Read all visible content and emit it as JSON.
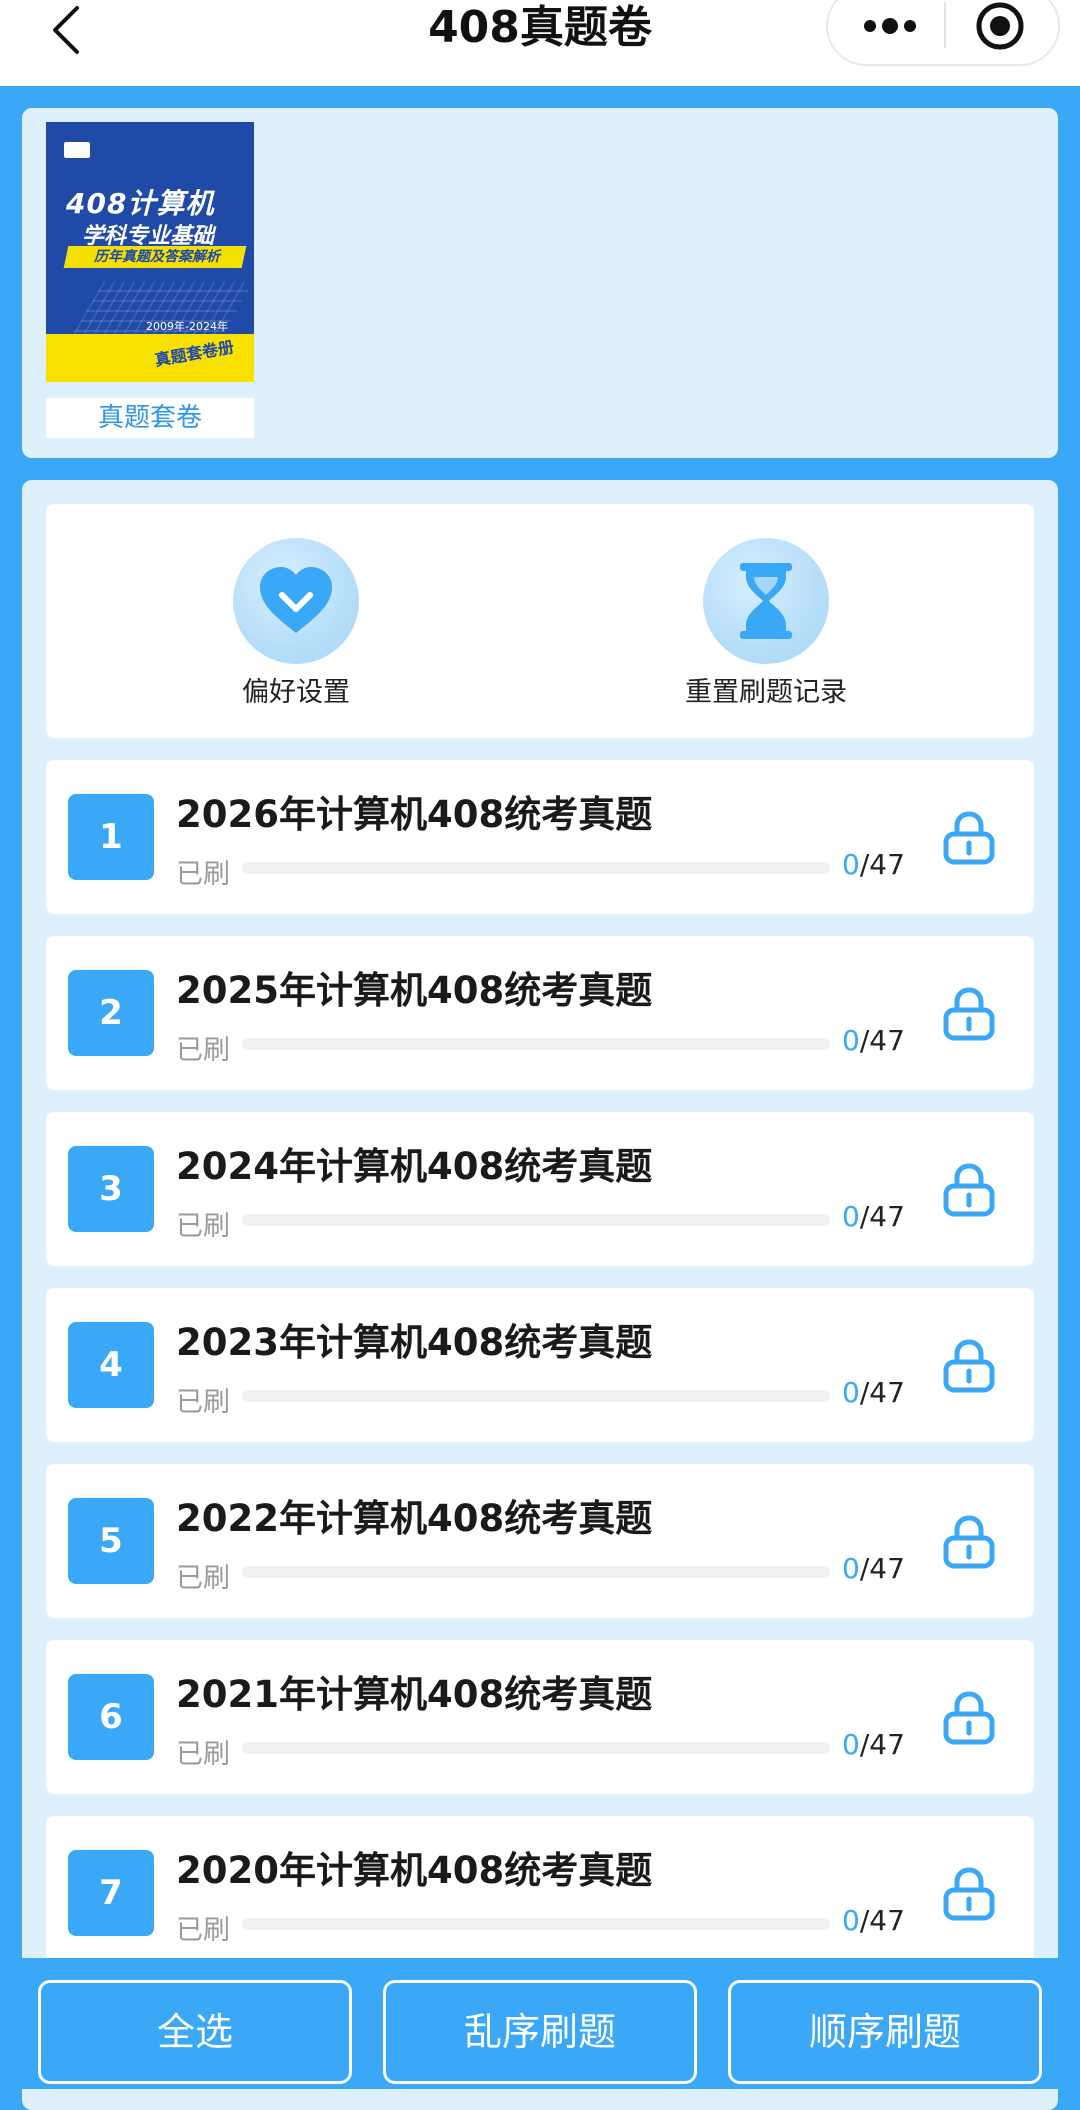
{
  "header": {
    "title": "408真题卷"
  },
  "book": {
    "cover_title_line1": "408计算机",
    "cover_title_line2": "学科专业基础",
    "cover_banner": "历年真题及答案解析",
    "cover_year_range": "2009年-2024年",
    "cover_volume": "真题套卷册",
    "label": "真题套卷"
  },
  "actions": [
    {
      "label": "偏好设置",
      "icon": "heart-check-icon"
    },
    {
      "label": "重置刷题记录",
      "icon": "hourglass-icon"
    }
  ],
  "items": [
    {
      "number": "1",
      "title": "2026年计算机408统考真题",
      "status_label": "已刷",
      "done": "0",
      "total": "/47",
      "progress": 0
    },
    {
      "number": "2",
      "title": "2025年计算机408统考真题",
      "status_label": "已刷",
      "done": "0",
      "total": "/47",
      "progress": 0
    },
    {
      "number": "3",
      "title": "2024年计算机408统考真题",
      "status_label": "已刷",
      "done": "0",
      "total": "/47",
      "progress": 0
    },
    {
      "number": "4",
      "title": "2023年计算机408统考真题",
      "status_label": "已刷",
      "done": "0",
      "total": "/47",
      "progress": 0
    },
    {
      "number": "5",
      "title": "2022年计算机408统考真题",
      "status_label": "已刷",
      "done": "0",
      "total": "/47",
      "progress": 0
    },
    {
      "number": "6",
      "title": "2021年计算机408统考真题",
      "status_label": "已刷",
      "done": "0",
      "total": "/47",
      "progress": 0
    },
    {
      "number": "7",
      "title": "2020年计算机408统考真题",
      "status_label": "已刷",
      "done": "0",
      "total": "/47",
      "progress": 0
    }
  ],
  "bottom_bar": {
    "select_all": "全选",
    "random_practice": "乱序刷题",
    "sequential_practice": "顺序刷题"
  },
  "colors": {
    "accent": "#3aa8f6",
    "panel": "#dff0fd",
    "progress_done": "#3aa8f6"
  }
}
